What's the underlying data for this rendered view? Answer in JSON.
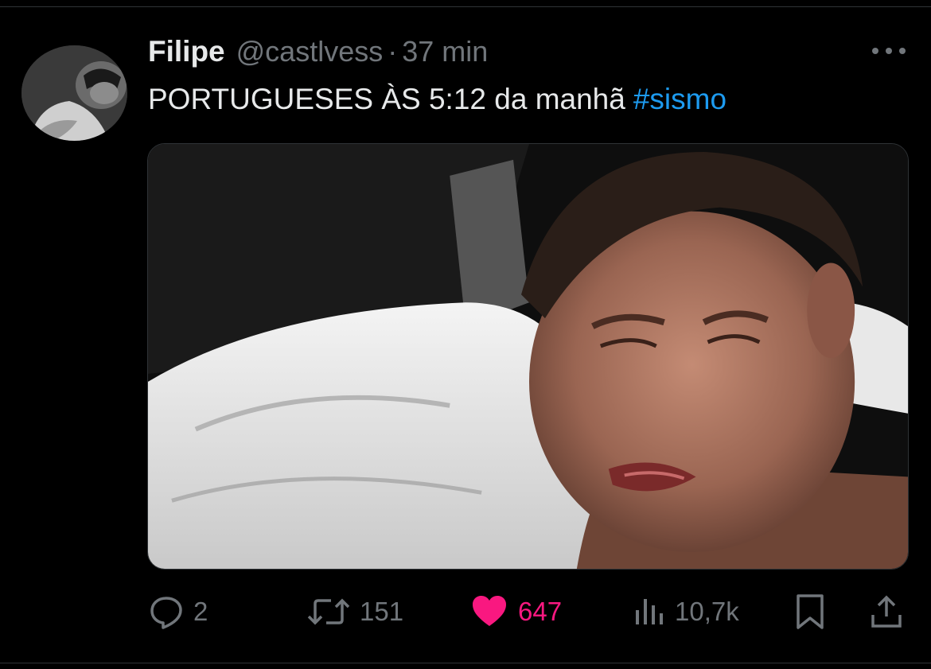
{
  "tweet": {
    "author": {
      "display_name": "Filipe",
      "handle": "@castlvess",
      "avatar_icon": "profile-photo"
    },
    "separator": "·",
    "time": "37 min",
    "text": "PORTUGUESES ÀS 5:12 da manhã",
    "hashtag": "#sismo",
    "media": {
      "description_icon": "photo"
    },
    "actions": {
      "replies": "2",
      "retweets": "151",
      "likes": "647",
      "views": "10,7k"
    },
    "colors": {
      "background": "#000000",
      "text": "#e7e9ea",
      "muted": "#71767b",
      "link": "#1d9bf0",
      "like": "#f91880"
    }
  }
}
